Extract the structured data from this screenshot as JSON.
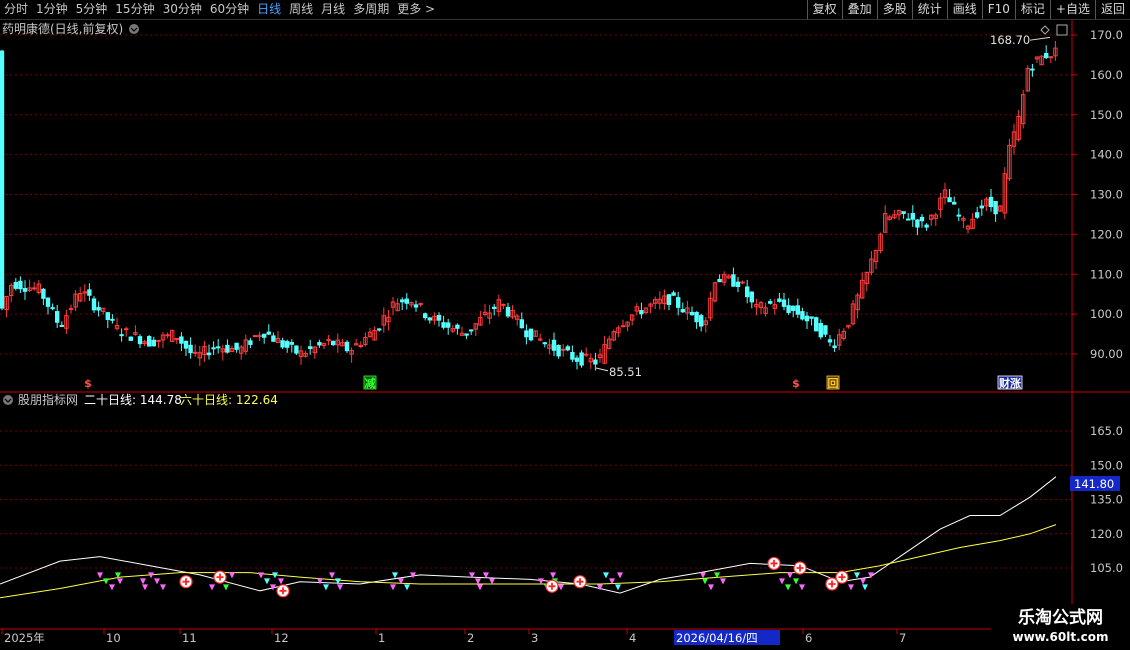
{
  "toolbar": {
    "periods": [
      "分时",
      "1分钟",
      "5分钟",
      "15分钟",
      "30分钟",
      "60分钟",
      "日线",
      "周线",
      "月线",
      "多周期",
      "更多"
    ],
    "active": "日线",
    "buttons": [
      "复权",
      "叠加",
      "多股",
      "统计",
      "画线",
      "F10",
      "标记",
      "+自选",
      "返回"
    ]
  },
  "main_panel": {
    "title": "药明康德(日线,前复权)",
    "price_labels": [
      "170.0",
      "160.0",
      "150.0",
      "140.0",
      "130.0",
      "120.0",
      "110.0",
      "100.0",
      "90.00"
    ],
    "high_label": "168.70",
    "low_label": "85.51",
    "markers": [
      "$",
      "减",
      "$",
      "回",
      "财涨"
    ]
  },
  "indicator_panel": {
    "name": "股朋指标网",
    "line1_label": "二十日线: 144.78",
    "line2_label": "六十日线: 122.64",
    "axis_labels": [
      "165.0",
      "150.0",
      "135.0",
      "120.0",
      "105.0"
    ],
    "current_value": "141.80"
  },
  "date_axis": {
    "labels": [
      "2025年",
      "10",
      "11",
      "12",
      "1",
      "2",
      "3",
      "4",
      "6",
      "7"
    ],
    "highlight": "2026/04/16/四"
  },
  "watermark": {
    "line1": "乐淘公式网",
    "line2": "www.60lt.com"
  },
  "colors": {
    "up": "#ff3c3c",
    "down": "#54ffff",
    "grid": "#7a0000",
    "axis": "#c80000",
    "ma20": "#ffffff",
    "ma60": "#ffff4a",
    "buy": "#33ff33",
    "sell": "#ff66ff"
  },
  "chart_data": {
    "type": "candlestick",
    "price_range": [
      85.51,
      168.7
    ],
    "series": [
      {
        "name": "二十日线",
        "last": 144.78
      },
      {
        "name": "六十日线",
        "last": 122.64
      }
    ]
  }
}
